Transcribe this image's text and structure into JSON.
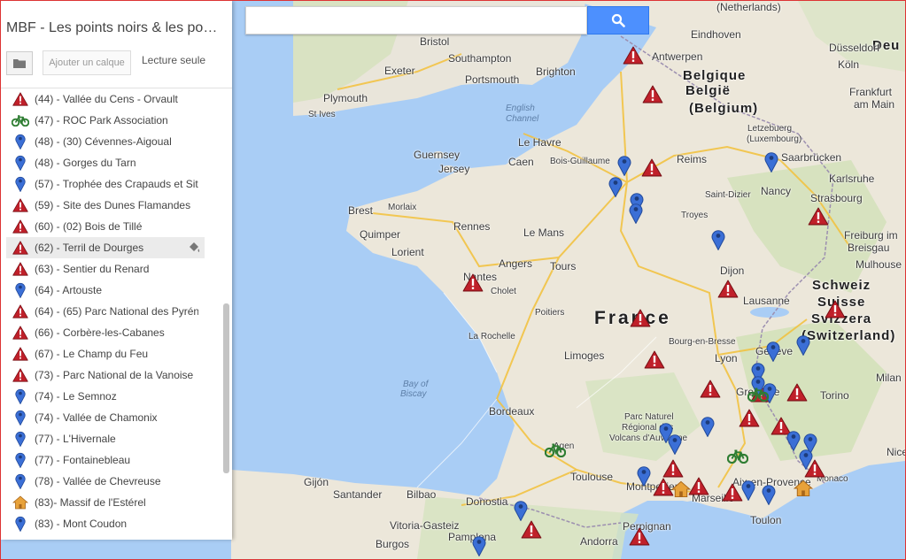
{
  "app": {
    "title": "MBF - Les points noirs & les poin…",
    "add_layer_label": "Ajouter un calque",
    "read_only_label": "Lecture seule",
    "search_placeholder": ""
  },
  "colors": {
    "accent": "#4d90fe",
    "warning_red": "#c0202a",
    "pin_blue": "#3b6fd6",
    "bike_green": "#2e7d32",
    "house_orange": "#e8a23a"
  },
  "list": [
    {
      "label": "(44) - Vallée du Cens - Orvault",
      "icon": "warning-icon"
    },
    {
      "label": "(47) - ROC Park Association",
      "icon": "bicycle-icon"
    },
    {
      "label": "(48) - (30) Cévennes-Aigoual",
      "icon": "pin-icon"
    },
    {
      "label": "(48) - Gorges du Tarn",
      "icon": "pin-icon"
    },
    {
      "label": "(57) - Trophée des Crapauds et Site",
      "icon": "pin-icon"
    },
    {
      "label": "(59) - Site des Dunes Flamandes",
      "icon": "warning-icon"
    },
    {
      "label": "(60) - (02) Bois de Tillé",
      "icon": "warning-icon"
    },
    {
      "label": "(62) - Terril de Dourges",
      "icon": "warning-icon",
      "active": true
    },
    {
      "label": "(63) - Sentier du Renard",
      "icon": "warning-icon"
    },
    {
      "label": "(64) - Artouste",
      "icon": "pin-icon"
    },
    {
      "label": "(64) - (65) Parc National des Pyréné",
      "icon": "warning-icon"
    },
    {
      "label": "(66) - Corbère-les-Cabanes",
      "icon": "warning-icon"
    },
    {
      "label": "(67) - Le Champ du Feu",
      "icon": "warning-icon"
    },
    {
      "label": "(73) - Parc National de la Vanoise",
      "icon": "warning-icon"
    },
    {
      "label": "(74) - Le Semnoz",
      "icon": "pin-icon"
    },
    {
      "label": "(74) - Vallée de Chamonix",
      "icon": "pin-icon"
    },
    {
      "label": "(77) - L'Hivernale",
      "icon": "pin-icon"
    },
    {
      "label": "(77) - Fontainebleau",
      "icon": "pin-icon"
    },
    {
      "label": "(78) - Vallée de Chevreuse",
      "icon": "pin-icon"
    },
    {
      "label": "(83)- Massif de l'Estérel",
      "icon": "house-icon"
    },
    {
      "label": "(83) - Mont Coudon",
      "icon": "pin-icon"
    }
  ],
  "places": [
    [
      "(Netherlands)",
      "",
      808,
      0
    ],
    [
      "Deu",
      "big",
      984,
      42
    ],
    [
      "Bristol",
      "",
      473,
      39
    ],
    [
      "Southampton",
      "",
      505,
      58
    ],
    [
      "Exeter",
      "",
      433,
      72
    ],
    [
      "Portsmouth",
      "",
      524,
      82
    ],
    [
      "Brighton",
      "",
      604,
      73
    ],
    [
      "Plymouth",
      "",
      364,
      103
    ],
    [
      "St Ives",
      "small",
      347,
      123
    ],
    [
      "English",
      "sea",
      570,
      116
    ],
    [
      "Channel",
      "sea",
      570,
      128
    ],
    [
      "Eindhoven",
      "",
      779,
      31
    ],
    [
      "Antwerpen",
      "",
      735,
      56
    ],
    [
      "Düsseldorf",
      "",
      935,
      46
    ],
    [
      "Belgique",
      "big",
      770,
      76
    ],
    [
      "België",
      "big",
      773,
      93
    ],
    [
      "(Belgium)",
      "big",
      777,
      113
    ],
    [
      "Köln",
      "",
      945,
      65
    ],
    [
      "Frankfurt",
      "",
      958,
      96
    ],
    [
      "am Main",
      "",
      963,
      110
    ],
    [
      "Letzebuerg",
      "small",
      843,
      139
    ],
    [
      "(Luxembourg)",
      "small",
      842,
      151
    ],
    [
      "Saarbrücken",
      "",
      881,
      170
    ],
    [
      "Nancy",
      "",
      858,
      208
    ],
    [
      "Strasbourg",
      "",
      914,
      216
    ],
    [
      "Karlsruhe",
      "",
      935,
      194
    ],
    [
      "Freiburg im",
      "",
      952,
      258
    ],
    [
      "Breisgau",
      "",
      956,
      272
    ],
    [
      "Guernsey",
      "",
      466,
      167
    ],
    [
      "Jersey",
      "",
      494,
      183
    ],
    [
      "Le Havre",
      "",
      584,
      153
    ],
    [
      "Caen",
      "",
      573,
      175
    ],
    [
      "Bois-Guillaume",
      "small",
      620,
      176
    ],
    [
      "Reims",
      "",
      763,
      172
    ],
    [
      "Saint-Dizier",
      "small",
      795,
      214
    ],
    [
      "Troyes",
      "small",
      768,
      237
    ],
    [
      "Brest",
      "",
      392,
      230
    ],
    [
      "Morlaix",
      "small",
      437,
      228
    ],
    [
      "Quimper",
      "",
      405,
      257
    ],
    [
      "Lorient",
      "",
      441,
      277
    ],
    [
      "Rennes",
      "",
      511,
      248
    ],
    [
      "Le Mans",
      "",
      590,
      255
    ],
    [
      "Angers",
      "",
      562,
      290
    ],
    [
      "Tours",
      "",
      620,
      293
    ],
    [
      "Nantes",
      "",
      522,
      305
    ],
    [
      "Cholet",
      "small",
      553,
      323
    ],
    [
      "Dijon",
      "",
      812,
      298
    ],
    [
      "Mulhouse",
      "",
      965,
      291
    ],
    [
      "Schweiz",
      "big",
      916,
      313
    ],
    [
      "Suisse",
      "big",
      922,
      332
    ],
    [
      "Svizzera",
      "big",
      915,
      351
    ],
    [
      "(Switzerland)",
      "big",
      904,
      370
    ],
    [
      "France",
      "huge",
      670,
      347
    ],
    [
      "Poitiers",
      "small",
      603,
      347
    ],
    [
      "La Rochelle",
      "small",
      528,
      374
    ],
    [
      "Limoges",
      "",
      636,
      394
    ],
    [
      "Lausanne",
      "",
      838,
      332
    ],
    [
      "Genève",
      "",
      852,
      389
    ],
    [
      "Bourg-en-Bresse",
      "small",
      754,
      380
    ],
    [
      "Lyon",
      "",
      806,
      397
    ],
    [
      "Bay of",
      "sea",
      454,
      428
    ],
    [
      "Biscay",
      "sea",
      451,
      439
    ],
    [
      "Grenoble",
      "",
      830,
      435
    ],
    [
      "Torino",
      "",
      925,
      439
    ],
    [
      "Milan",
      "",
      988,
      419
    ],
    [
      "Bordeaux",
      "",
      551,
      457
    ],
    [
      "Parc Naturel",
      "small",
      704,
      465
    ],
    [
      "Régional des",
      "small",
      701,
      477
    ],
    [
      "Volcans d'Auvergne",
      "small",
      687,
      489
    ],
    [
      "Agen",
      "small",
      624,
      498
    ],
    [
      "Toulouse",
      "",
      643,
      531
    ],
    [
      "Montpellier",
      "",
      706,
      542
    ],
    [
      "Aix-en-Provence",
      "",
      826,
      537
    ],
    [
      "Marseille",
      "",
      780,
      555
    ],
    [
      "Monaco",
      "small",
      921,
      535
    ],
    [
      "Toulon",
      "",
      846,
      580
    ],
    [
      "Gijón",
      "",
      342,
      537
    ],
    [
      "Santander",
      "",
      375,
      551
    ],
    [
      "Bilbao",
      "",
      458,
      551
    ],
    [
      "Donostia",
      "",
      525,
      559
    ],
    [
      "Vitoria-Gasteiz",
      "",
      439,
      586
    ],
    [
      "Pamplona",
      "",
      505,
      599
    ],
    [
      "Burgos",
      "",
      423,
      607
    ],
    [
      "Andorra",
      "",
      654,
      604
    ],
    [
      "Perpignan",
      "",
      702,
      587
    ],
    [
      "Nice",
      "",
      1000,
      503
    ]
  ]
}
